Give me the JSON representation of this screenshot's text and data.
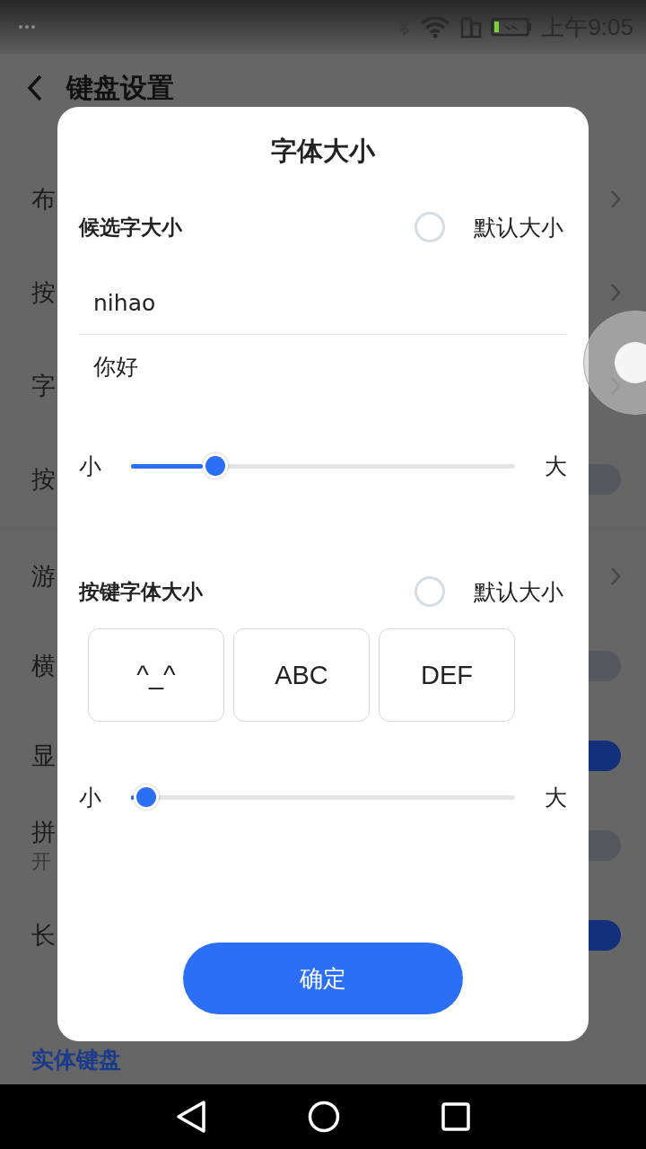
{
  "status_bar": {
    "time": "上午9:05"
  },
  "header": {
    "title": "键盘设置"
  },
  "groups": [
    {
      "items": [
        {
          "label": "布",
          "kind": "link"
        },
        {
          "label": "按",
          "kind": "link"
        },
        {
          "label": "字",
          "kind": "link"
        },
        {
          "label": "按",
          "kind": "toggle",
          "on": false
        }
      ]
    },
    {
      "items": [
        {
          "label": "游",
          "kind": "link"
        },
        {
          "label": "横",
          "kind": "toggle",
          "on": false
        },
        {
          "label": "显",
          "kind": "toggle",
          "on": true
        },
        {
          "label": "拼",
          "subtitle": "开",
          "kind": "toggle",
          "on": false
        },
        {
          "label": "长",
          "kind": "toggle",
          "on": true
        }
      ]
    }
  ],
  "section_header": "实体键盘",
  "dialog": {
    "title": "字体大小",
    "candidate": {
      "label": "候选字大小",
      "default_option": {
        "label": "默认大小",
        "selected": false
      },
      "preview_lines": [
        "nihao",
        "你好"
      ],
      "slider": {
        "min_label": "小",
        "max_label": "大",
        "level": 0.22
      }
    },
    "keys": {
      "label": "按键字体大小",
      "default_option": {
        "label": "默认大小",
        "selected": false
      },
      "previews": [
        "^_^",
        "ABC",
        "DEF"
      ],
      "slider": {
        "min_label": "小",
        "max_label": "大",
        "level": 0.04
      }
    },
    "confirm": "确定"
  }
}
